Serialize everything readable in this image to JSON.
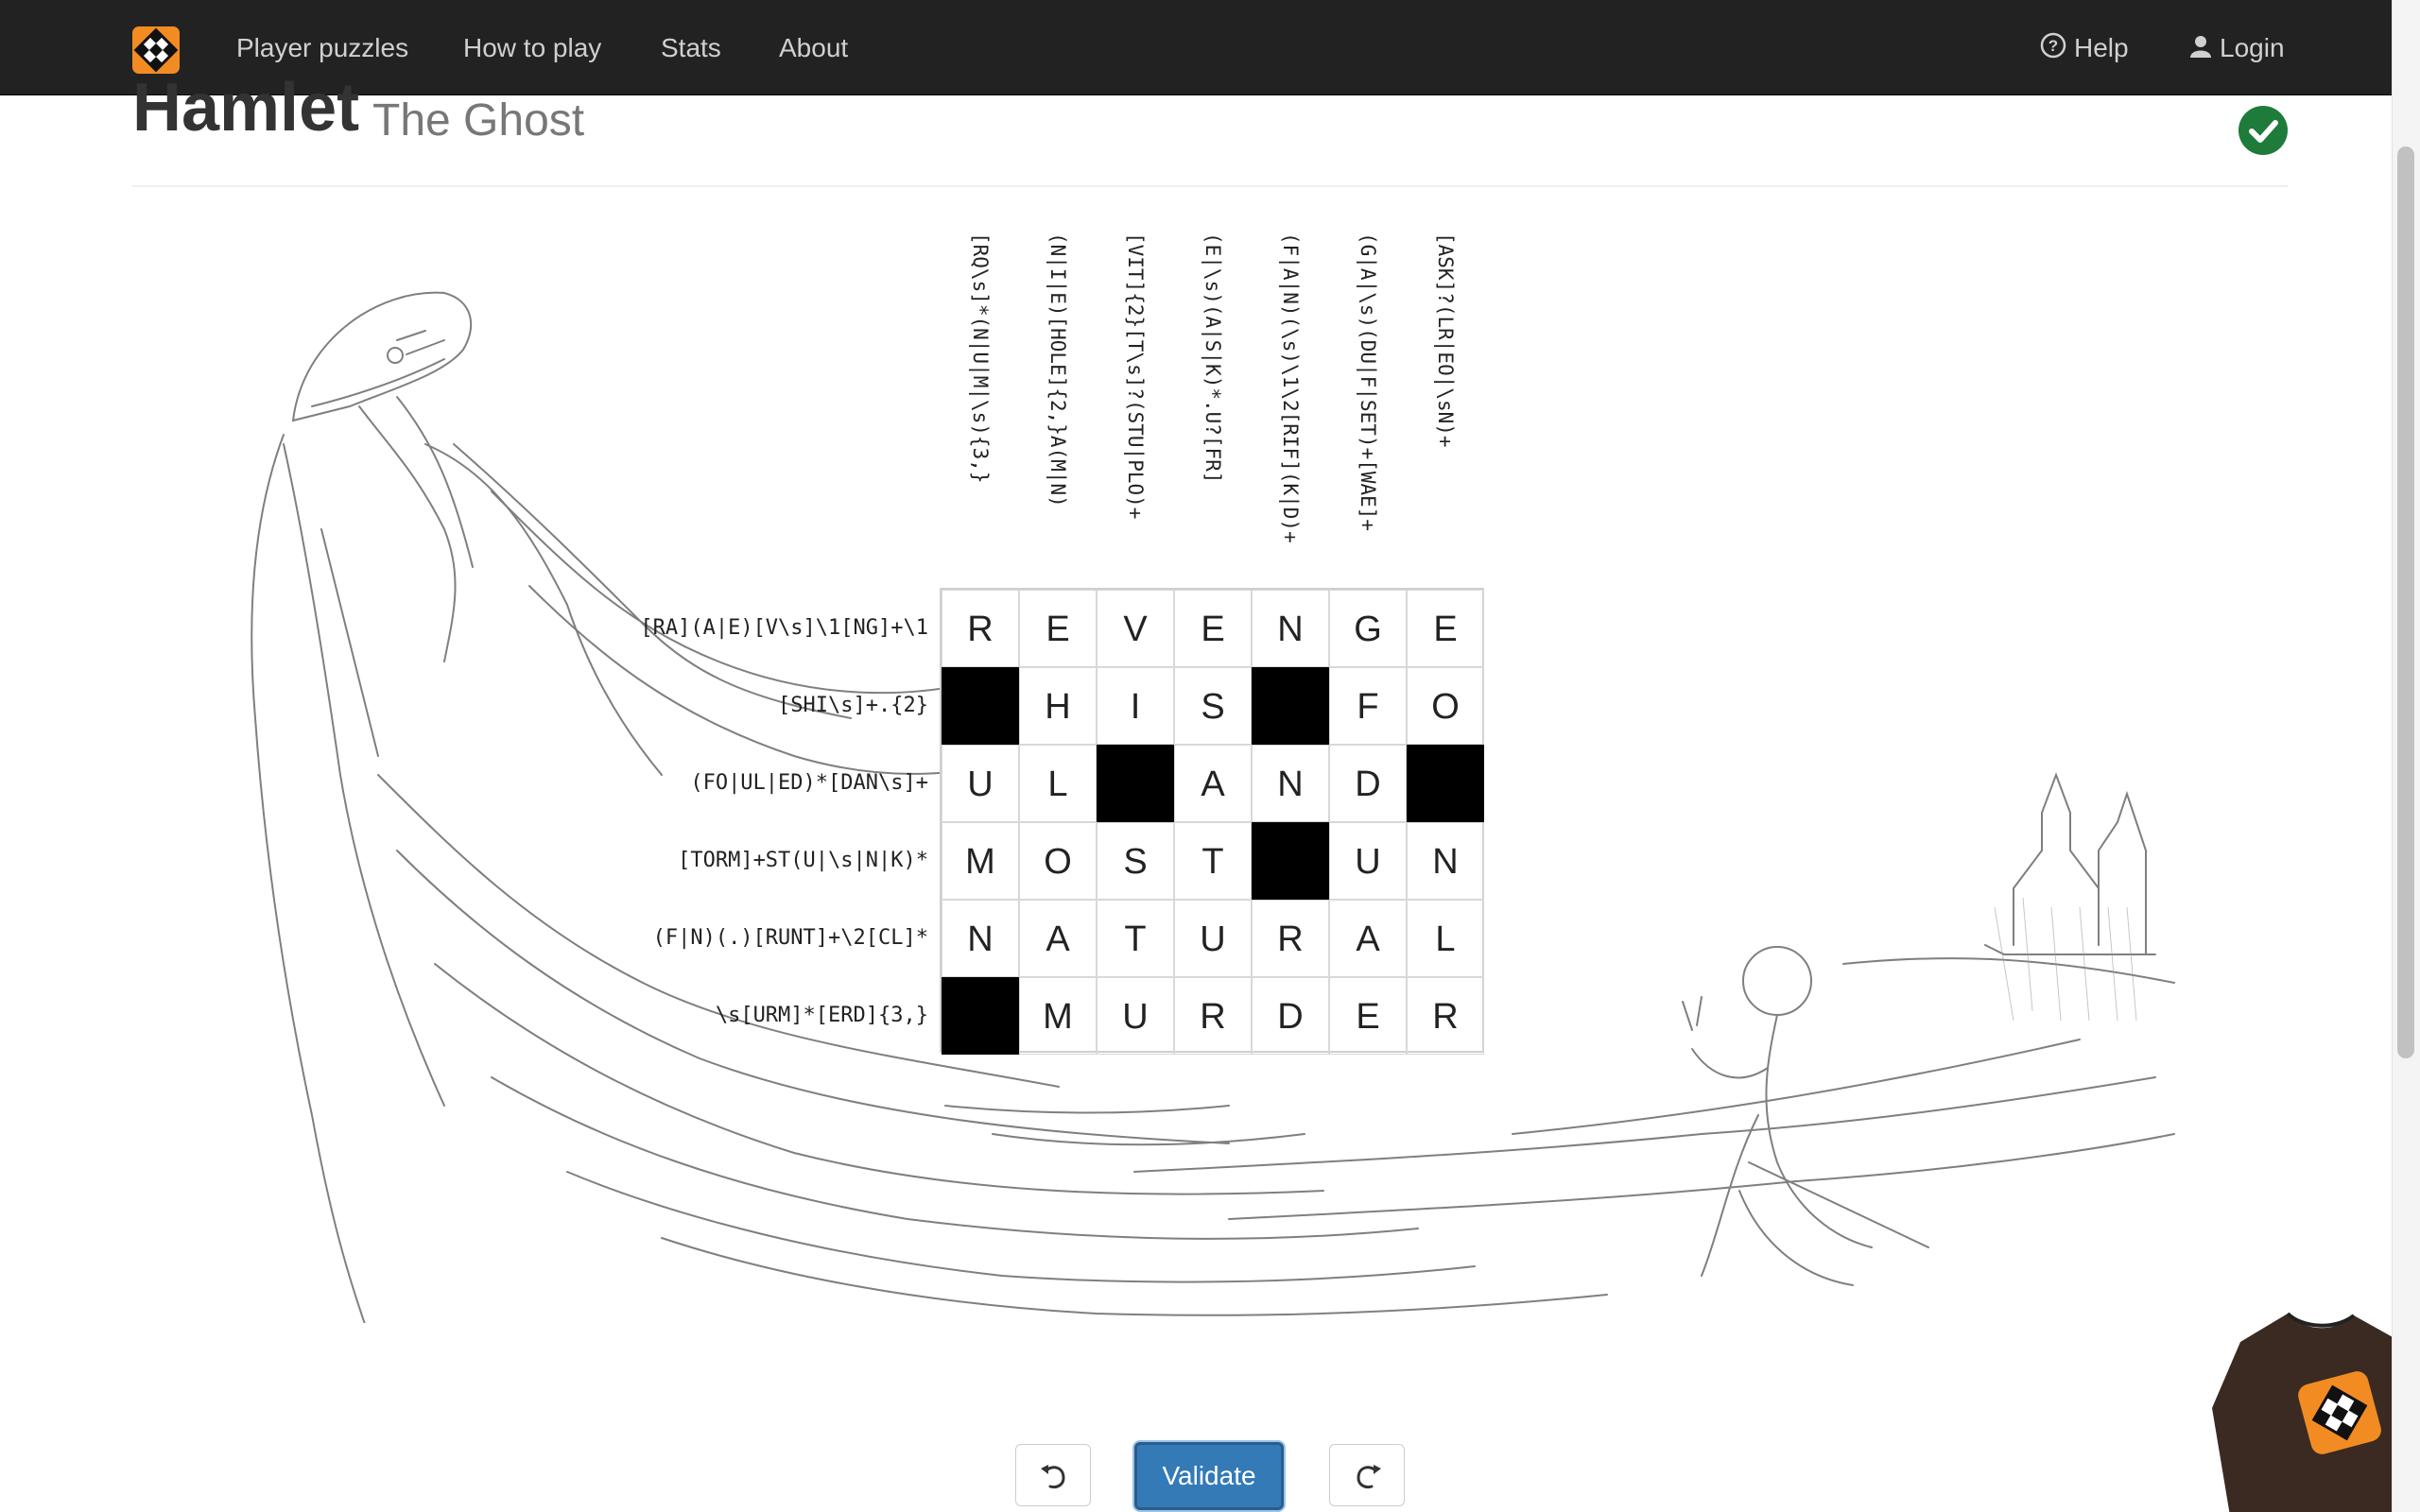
{
  "navbar": {
    "links": [
      {
        "label": "Player puzzles"
      },
      {
        "label": "How to play"
      },
      {
        "label": "Stats"
      },
      {
        "label": "About"
      }
    ],
    "help_label": "Help",
    "login_label": "Login"
  },
  "puzzle": {
    "title": "Hamlet",
    "subtitle": "The Ghost",
    "column_clues": [
      "[RQ\\s]*(N|U|M|\\s){3,}",
      "(N|I|E)[HOLE]{2,}A(M|N)",
      "[VIT]{2}[T\\s]?(STU|PLO)+",
      "(E|\\s)(A|S|K)*.U?[FR]",
      "(F|A|N)(\\s)\\1\\2[RIF](K|D)+",
      "(G|A|\\s)(DU|F|SET)+[WAE]+",
      "[ASK]?(LR|EO|\\sN)+"
    ],
    "row_clues": [
      "[RA](A|E)[V\\s]\\1[NG]+\\1",
      "[SHI\\s]+.{2}",
      "(FO|UL|ED)*[DAN\\s]+",
      "[TORM]+ST(U|\\s|N|K)*",
      "(F|N)(.)[RUNT]+\\2[CL]*",
      "\\s[URM]*[ERD]{3,}"
    ],
    "grid": [
      [
        "R",
        "E",
        "V",
        "E",
        "N",
        "G",
        "E"
      ],
      [
        "#",
        "H",
        "I",
        "S",
        "#",
        "F",
        "O"
      ],
      [
        "U",
        "L",
        "#",
        "A",
        "N",
        "D",
        "#"
      ],
      [
        "M",
        "O",
        "S",
        "T",
        "#",
        "U",
        "N"
      ],
      [
        "N",
        "A",
        "T",
        "U",
        "R",
        "A",
        "L"
      ],
      [
        "#",
        "M",
        "U",
        "R",
        "D",
        "E",
        "R"
      ]
    ],
    "solved": true
  },
  "controls": {
    "undo_icon": "undo-icon",
    "validate_label": "Validate",
    "redo_icon": "redo-icon"
  },
  "colors": {
    "navbar_bg": "#222222",
    "brand_orange": "#f28c22",
    "validate_blue": "#337ab7",
    "solved_green": "#1e7b3a"
  }
}
